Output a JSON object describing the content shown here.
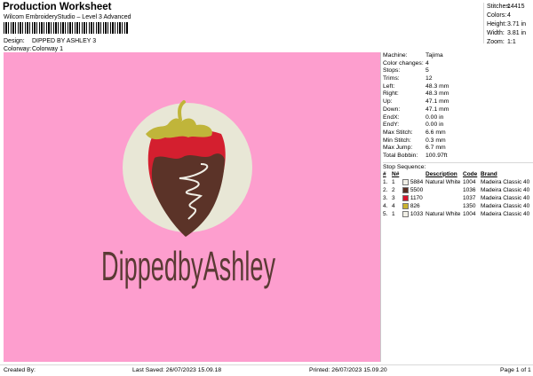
{
  "header": {
    "title": "Production Worksheet",
    "subtitle": "Wilcom EmbroideryStudio – Level 3 Advanced"
  },
  "meta": {
    "design_label": "Design:",
    "design_value": "DIPPED BY ASHLEY 3",
    "colorway_label": "Colorway:",
    "colorway_value": "Colorway 1"
  },
  "top_stats": [
    {
      "label": "Stitches:",
      "value": "14415"
    },
    {
      "label": "Colors:",
      "value": "4"
    },
    {
      "label": "Height:",
      "value": "3.71 in"
    },
    {
      "label": "Width:",
      "value": "3.81 in"
    },
    {
      "label": "Zoom:",
      "value": "1:1"
    }
  ],
  "details": [
    {
      "label": "Machine:",
      "value": "Tajima"
    },
    {
      "label": "Color changes:",
      "value": "4"
    },
    {
      "label": "Stops:",
      "value": "5"
    },
    {
      "label": "Trims:",
      "value": "12"
    },
    {
      "label": "Left:",
      "value": "48.3 mm"
    },
    {
      "label": "Right:",
      "value": "48.3 mm"
    },
    {
      "label": "Up:",
      "value": "47.1 mm"
    },
    {
      "label": "Down:",
      "value": "47.1 mm"
    },
    {
      "label": "EndX:",
      "value": "0.00 in"
    },
    {
      "label": "EndY:",
      "value": "0.00 in"
    },
    {
      "label": "Max Stitch:",
      "value": "6.6 mm"
    },
    {
      "label": "Min Stitch:",
      "value": "0.3 mm"
    },
    {
      "label": "Max Jump:",
      "value": "6.7 mm"
    },
    {
      "label": "Total Bobbin:",
      "value": "100.97ft"
    }
  ],
  "sequence": {
    "title": "Stop Sequence:",
    "headers": [
      "#",
      "N#",
      "",
      "Description",
      "Code",
      "Brand"
    ],
    "rows": [
      {
        "idx": "1.",
        "n": "1",
        "code_no": "5884",
        "color": "#f1efe6",
        "desc": "Natural White",
        "code": "1004",
        "brand": "Madeira Classic 40"
      },
      {
        "idx": "2.",
        "n": "2",
        "code_no": "5500",
        "color": "#5a2e23",
        "desc": "",
        "code": "1036",
        "brand": "Madeira Classic 40"
      },
      {
        "idx": "3.",
        "n": "3",
        "code_no": "1170",
        "color": "#d8142c",
        "desc": "",
        "code": "1037",
        "brand": "Madeira Classic 40"
      },
      {
        "idx": "4.",
        "n": "4",
        "code_no": "826",
        "color": "#c9b230",
        "desc": "",
        "code": "1350",
        "brand": "Madeira Classic 40"
      },
      {
        "idx": "5.",
        "n": "1",
        "code_no": "1033",
        "color": "#f1efe6",
        "desc": "Natural White",
        "code": "1004",
        "brand": "Madeira Classic 40"
      }
    ]
  },
  "design": {
    "text": "DippedbyAshley",
    "background_color": "#fd9ece",
    "circle_color": "#e8e7d6",
    "chocolate_color": "#5b3328",
    "strawberry_color": "#d41f2f",
    "leaf_color": "#c0b53a",
    "text_color": "#5a3a34"
  },
  "footer": {
    "created_by": "Created By:",
    "last_saved": "Last Saved: 26/07/2023 15.09.18",
    "printed": "Printed: 26/07/2023 15.09.20",
    "page": "Page 1 of 1"
  }
}
